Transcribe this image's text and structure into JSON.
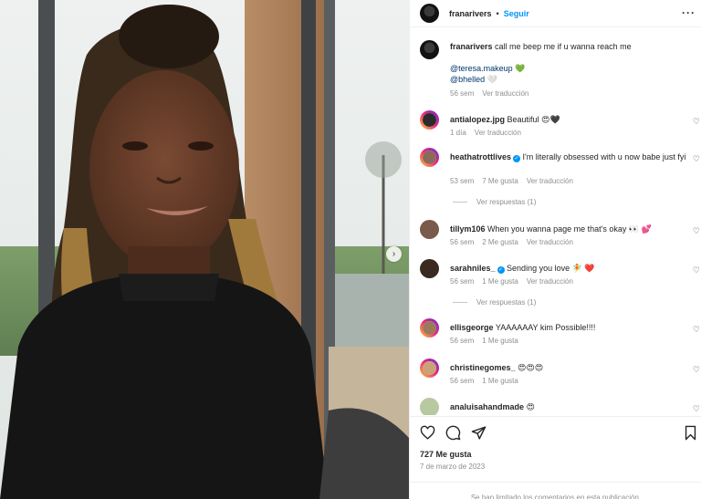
{
  "header": {
    "username": "franarivers",
    "dot": "•",
    "follow_label": "Seguir",
    "more_label": "···"
  },
  "caption": {
    "username": "franarivers",
    "text": "call me beep me if u wanna reach me",
    "mention1": "@teresa.makeup",
    "mention1_emoji": "💚",
    "mention2": "@bhelled",
    "mention2_emoji": "🤍",
    "time": "56 sem",
    "translate": "Ver traducción"
  },
  "comments": [
    {
      "username": "antialopez.jpg",
      "text": "Beautiful 😍🖤",
      "time": "1 día",
      "likes": "",
      "translate": "Ver traducción"
    },
    {
      "username": "heathatrottlives",
      "verified": "✓",
      "text": "I'm literally obsessed with u now babe just fyi",
      "time": "53 sem",
      "likes": "7 Me gusta",
      "translate": "Ver traducción",
      "replies": "Ver respuestas (1)"
    },
    {
      "username": "tillym106",
      "text": "When you wanna page me that's okay 👀 💕",
      "time": "56 sem",
      "likes": "2 Me gusta",
      "translate": "Ver traducción"
    },
    {
      "username": "sarahniles_",
      "verified": "✓",
      "text": "Sending you love 🧚 ❤️",
      "time": "56 sem",
      "likes": "1 Me gusta",
      "translate": "Ver traducción",
      "replies": "Ver respuestas (1)"
    },
    {
      "username": "ellisgeorge",
      "text": "YAAAAAAY kim Possible!!!!",
      "time": "56 sem",
      "likes": "1 Me gusta"
    },
    {
      "username": "christinegomes_",
      "text": "😍😍😍",
      "time": "56 sem",
      "likes": "1 Me gusta"
    },
    {
      "username": "analuisahandmade",
      "text": "😍"
    }
  ],
  "heart_glyph": "♡",
  "next_glyph": "›",
  "footer": {
    "likes": "727 Me gusta",
    "date": "7 de marzo de 2023",
    "limited": "Se han limitado los comentarios en esta publicación."
  },
  "colors": {
    "accent": "#0095f6",
    "muted": "#8e8e8e",
    "text": "#262626"
  }
}
